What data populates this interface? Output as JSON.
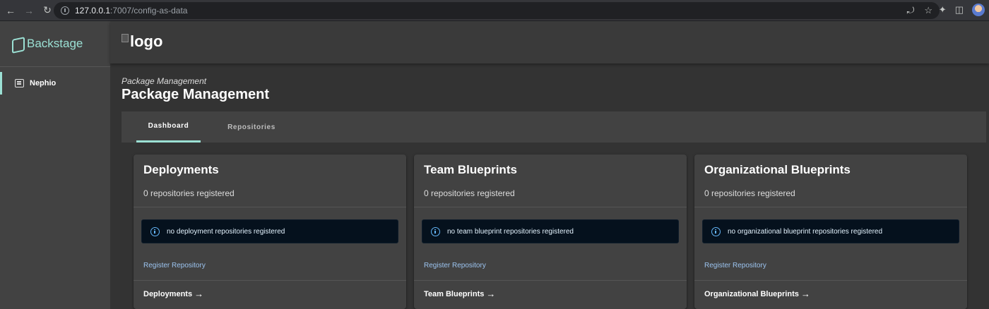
{
  "browser": {
    "url_host": "127.0.0.1",
    "url_path": ":7007/config-as-data"
  },
  "sidebar": {
    "brand": "Backstage",
    "items": [
      {
        "label": "Nephio",
        "icon": "library-books-icon"
      }
    ]
  },
  "header": {
    "logo_alt": "logo"
  },
  "page": {
    "breadcrumb": "Package Management",
    "title": "Package Management"
  },
  "tabs": [
    {
      "label": "Dashboard",
      "active": true
    },
    {
      "label": "Repositories",
      "active": false
    }
  ],
  "cards": [
    {
      "title": "Deployments",
      "subtitle": "0 repositories registered",
      "alert": "no deployment repositories registered",
      "register_link": "Register Repository",
      "footer_link": "Deployments"
    },
    {
      "title": "Team Blueprints",
      "subtitle": "0 repositories registered",
      "alert": "no team blueprint repositories registered",
      "register_link": "Register Repository",
      "footer_link": "Team Blueprints"
    },
    {
      "title": "Organizational Blueprints",
      "subtitle": "0 repositories registered",
      "alert": "no organizational blueprint repositories registered",
      "register_link": "Register Repository",
      "footer_link": "Organizational Blueprints"
    }
  ],
  "colors": {
    "accent": "#9be0d4",
    "link": "#9cc4f0",
    "info": "#64b5f6",
    "alert_bg": "#05111d",
    "card_bg": "#424242",
    "page_bg": "#333333"
  }
}
